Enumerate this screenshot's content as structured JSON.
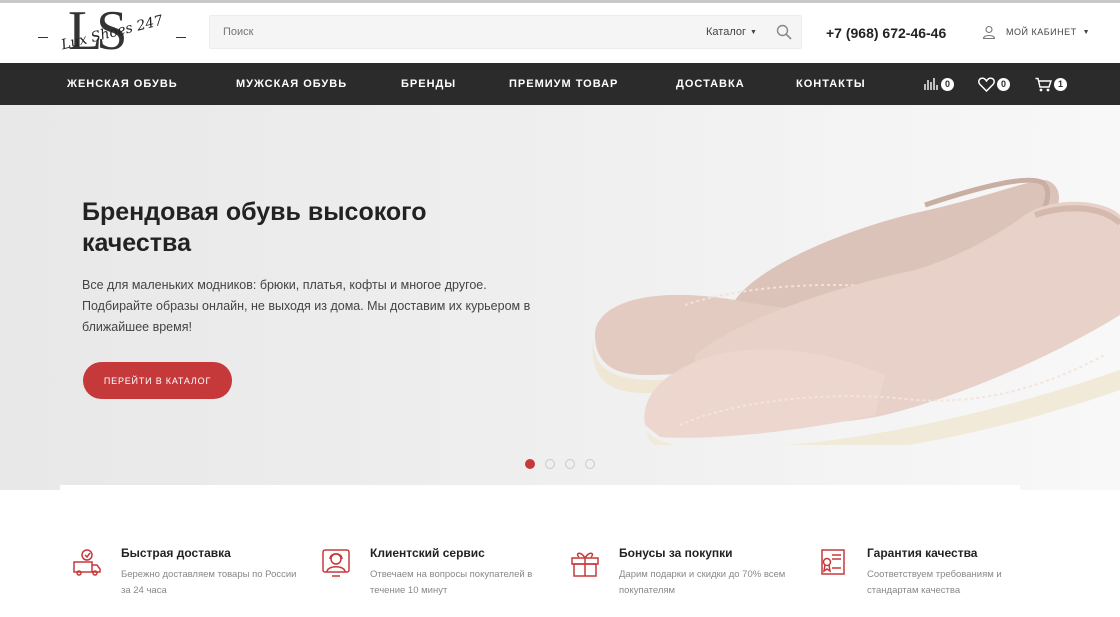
{
  "brand": {
    "logo_letters": "LS",
    "logo_script": "Lux Shoes 247"
  },
  "search": {
    "placeholder": "Поиск",
    "catalog_label": "Каталог"
  },
  "header": {
    "phone": "+7 (968) 672-46-46",
    "account_label": "МОЙ КАБИНЕТ"
  },
  "nav": {
    "items": [
      "ЖЕНСКАЯ ОБУВЬ",
      "МУЖСКАЯ ОБУВЬ",
      "БРЕНДЫ",
      "ПРЕМИУМ ТОВАР",
      "ДОСТАВКА",
      "КОНТАКТЫ"
    ],
    "compare_count": "0",
    "favorites_count": "0",
    "cart_count": "1"
  },
  "hero": {
    "title": "Брендовая обувь высокого качества",
    "text": "Все для маленьких модников: брюки, платья, кофты и многое другое. Подбирайте образы онлайн, не выходя из дома. Мы доставим их курьером в ближайшее время!",
    "button_label": "ПЕРЕЙТИ В КАТАЛОГ",
    "slide_count": 4,
    "active_slide": 1
  },
  "features": [
    {
      "icon": "delivery-truck-icon",
      "title": "Быстрая доставка",
      "desc": "Бережно доставляем товары по России за 24 часа"
    },
    {
      "icon": "support-agent-icon",
      "title": "Клиентский сервис",
      "desc": "Отвечаем на вопросы покупателей в течение 10 минут"
    },
    {
      "icon": "gift-icon",
      "title": "Бонусы за покупки",
      "desc": "Дарим подарки и скидки до 70% всем покупателям"
    },
    {
      "icon": "certificate-icon",
      "title": "Гарантия качества",
      "desc": "Соответствуем требованиям и стандартам качества"
    }
  ],
  "colors": {
    "accent": "#c6393b",
    "nav_bg": "#2b2b2b",
    "icon_red": "#c6393b"
  }
}
